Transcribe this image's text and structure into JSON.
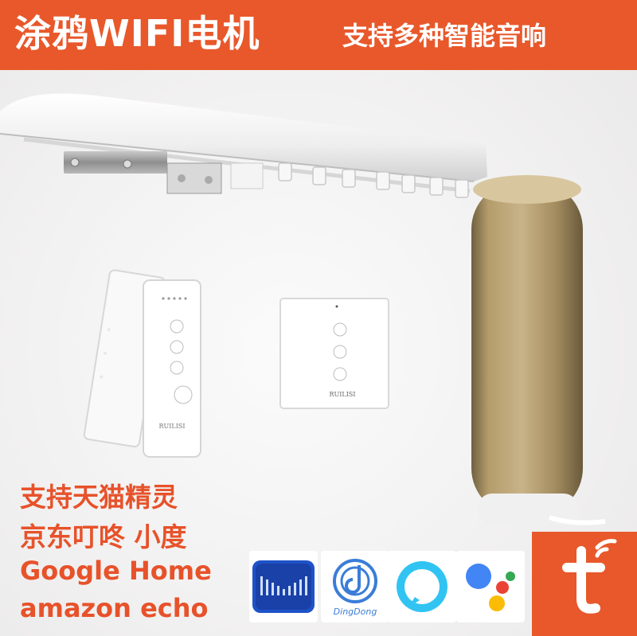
{
  "banner": {
    "title": "涂鸦WIFI电机",
    "subtitle": "支持多种智能音响",
    "color": "#e8582b"
  },
  "photo": {
    "remote_brand": "RUILISI",
    "wall_switch_brand": "RUILISI"
  },
  "features": [
    "支持天猫精灵",
    "京东叮咚 小度",
    "Google Home",
    "amazon echo"
  ],
  "feature_color": "#e7522a",
  "logos": [
    {
      "name": "tmall-genie-icon"
    },
    {
      "name": "dingdong-icon",
      "label": "DingDong"
    },
    {
      "name": "alexa-icon"
    },
    {
      "name": "google-assistant-icon"
    },
    {
      "name": "tuya-icon"
    }
  ]
}
